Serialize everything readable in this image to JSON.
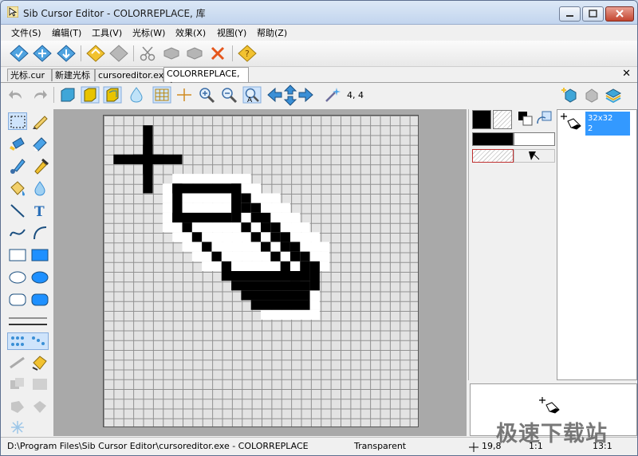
{
  "window": {
    "title": "Sib Cursor Editor - COLORREPLACE, 库"
  },
  "menu": [
    "文件(S)",
    "编辑(T)",
    "工具(V)",
    "光标(W)",
    "效果(X)",
    "视图(Y)",
    "帮助(Z)"
  ],
  "tabs": [
    "光标.cur",
    "新建光标",
    "cursoreditor.exe",
    "COLORREPLACE, 库"
  ],
  "tab_close": "✕",
  "toolbar2": {
    "coordinates": "4, 4"
  },
  "image_list": {
    "size": "32x32",
    "depth": "2"
  },
  "status": {
    "path": "D:\\Program Files\\Sib Cursor Editor\\cursoreditor.exe - COLORREPLACE",
    "transparent": "Transparent",
    "position": "19,8",
    "size": "1:1",
    "zoom": "13:1"
  },
  "watermark": "极速下载站",
  "colors": {
    "accent": "#3399ff",
    "transparent_grid": "#e3e3e3",
    "close_button": "#c3452f"
  }
}
